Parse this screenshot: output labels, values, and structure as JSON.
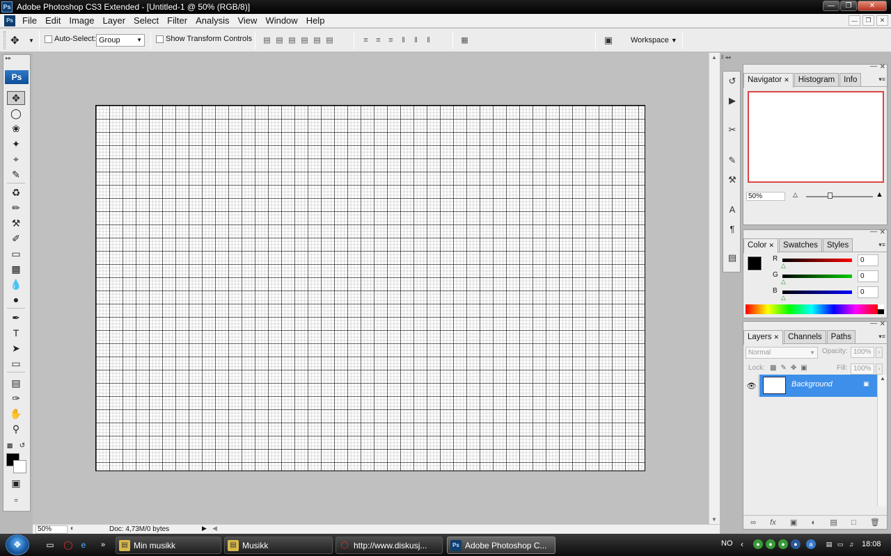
{
  "window": {
    "title": "Adobe Photoshop CS3 Extended - [Untitled-1 @ 50% (RGB/8)]",
    "app_icon_text": "Ps"
  },
  "menu": {
    "items": [
      "File",
      "Edit",
      "Image",
      "Layer",
      "Select",
      "Filter",
      "Analysis",
      "View",
      "Window",
      "Help"
    ]
  },
  "options_bar": {
    "auto_select_label": "Auto-Select:",
    "auto_select_checked": false,
    "auto_select_value": "Group",
    "show_transform_label": "Show Transform Controls",
    "show_transform_checked": false,
    "workspace_label": "Workspace"
  },
  "toolbox": {
    "logo": "Ps",
    "tools": [
      "move",
      "elliptical-marquee",
      "lasso",
      "magic-wand",
      "crop",
      "slice",
      "healing-brush",
      "brush",
      "clone-stamp",
      "history-brush",
      "eraser",
      "gradient",
      "blur",
      "dodge",
      "pen",
      "type",
      "path-selection",
      "rectangle",
      "notes",
      "eyedropper",
      "hand",
      "zoom"
    ],
    "active_tool": "move",
    "foreground_color": "#000000",
    "background_color": "#ffffff"
  },
  "document": {
    "zoom": "50%",
    "doc_size": "Doc: 4,73M/0 bytes",
    "canvas_color": "#ffffff",
    "grid": true
  },
  "navigator_panel": {
    "tabs": [
      "Navigator",
      "Histogram",
      "Info"
    ],
    "active_tab": "Navigator",
    "zoom": "50%",
    "view_box_color": "#dd4444"
  },
  "color_panel": {
    "tabs": [
      "Color",
      "Swatches",
      "Styles"
    ],
    "active_tab": "Color",
    "channels": [
      {
        "label": "R",
        "value": "0",
        "color": "#cc0000"
      },
      {
        "label": "G",
        "value": "0",
        "color": "#00aa00"
      },
      {
        "label": "B",
        "value": "0",
        "color": "#0000cc"
      }
    ]
  },
  "layers_panel": {
    "tabs": [
      "Layers",
      "Channels",
      "Paths"
    ],
    "active_tab": "Layers",
    "blend_mode": "Normal",
    "opacity_label": "Opacity:",
    "opacity": "100%",
    "lock_label": "Lock:",
    "fill_label": "Fill:",
    "fill": "100%",
    "layers": [
      {
        "name": "Background",
        "visible": true,
        "locked": true,
        "selected": true
      }
    ]
  },
  "taskbar": {
    "tasks": [
      {
        "label": "Min musikk",
        "icon": "folder-icon",
        "active": false
      },
      {
        "label": "Musikk",
        "icon": "folder-icon",
        "active": false
      },
      {
        "label": "http://www.diskusj...",
        "icon": "opera-icon",
        "active": false
      },
      {
        "label": "Adobe Photoshop C...",
        "icon": "photoshop-icon",
        "active": true
      }
    ],
    "language": "NO",
    "clock": "18:08"
  }
}
